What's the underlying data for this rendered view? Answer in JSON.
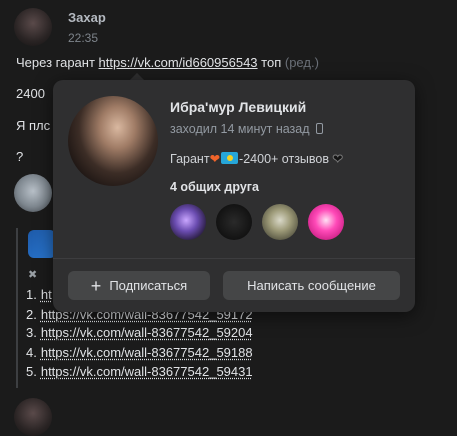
{
  "message": {
    "author": "Захар",
    "time": "22:35",
    "line1_text": "Через гарант ",
    "line1_link": "https://vk.com/id660956543",
    "line1_suffix": " топ",
    "edited": "(ред.)",
    "line2": "2400",
    "line3": "Я плс",
    "line4": "?"
  },
  "forwarded_links": [
    {
      "num": "1.",
      "url": "ht"
    },
    {
      "num": "2.",
      "url": "https://vk.com/wall-83677542_59172"
    },
    {
      "num": "3.",
      "url": "https://vk.com/wall-83677542_59204"
    },
    {
      "num": "4.",
      "url": "https://vk.com/wall-83677542_59188"
    },
    {
      "num": "5.",
      "url": "https://vk.com/wall-83677542_59431"
    }
  ],
  "profile_popup": {
    "name": "Ибра'мур Левицкий",
    "status": "заходил 14 минут назад",
    "desc_prefix": "Гарант",
    "desc_suffix": "-2400+ отзывов",
    "mutual_friends_title": "4 общих друга",
    "subscribe_label": "Подписаться",
    "message_label": "Написать сообщение"
  }
}
